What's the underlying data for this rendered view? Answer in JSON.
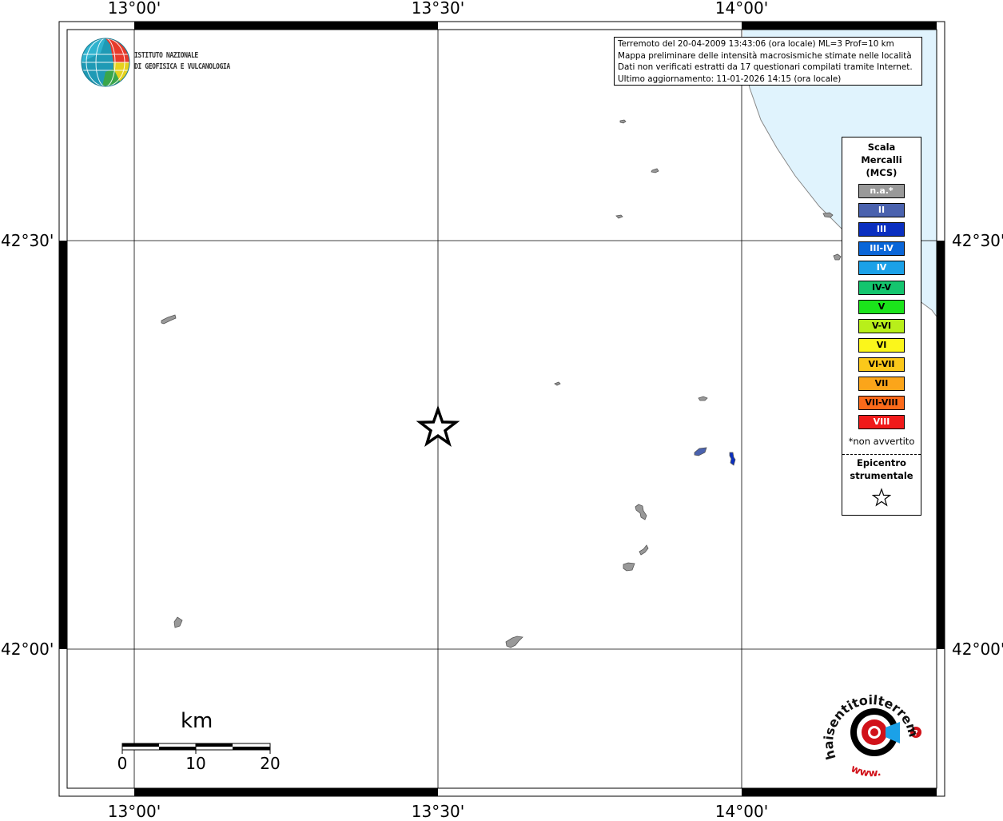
{
  "map": {
    "lon_ticks": [
      "13°00'",
      "13°30'",
      "14°00'"
    ],
    "lat_ticks": [
      "42°30'",
      "42°00'"
    ],
    "sea_color": "#e0f3fd",
    "land_color": "#ffffff"
  },
  "info": {
    "lines": [
      "Terremoto del 20-04-2009 13:43:06 (ora locale) ML=3 Prof=10 km",
      "Mappa preliminare delle intensità macrosismiche stimate nelle località",
      "Dati non verificati estratti da 17 questionari compilati tramite Internet.",
      "Ultimo aggiornamento: 11-01-2026 14:15 (ora locale)"
    ]
  },
  "logo_ingv": {
    "line1": "ISTITUTO NAZIONALE",
    "line2": "DI GEOFISICA E VULCANOLOGIA"
  },
  "legend": {
    "title_lines": [
      "Scala",
      "Mercalli",
      "(MCS)"
    ],
    "classes": [
      {
        "label": "n.a.*",
        "color": "#999999",
        "text_color": "#ffffff"
      },
      {
        "label": "II",
        "color": "#4a62ae",
        "text_color": "#ffffff"
      },
      {
        "label": "III",
        "color": "#0a2fc0",
        "text_color": "#ffffff"
      },
      {
        "label": "III-IV",
        "color": "#0a66d8",
        "text_color": "#ffffff"
      },
      {
        "label": "IV",
        "color": "#1ba1e8",
        "text_color": "#ffffff"
      },
      {
        "label": "IV-V",
        "color": "#14c56e",
        "text_color": "#000000"
      },
      {
        "label": "V",
        "color": "#1be41b",
        "text_color": "#000000"
      },
      {
        "label": "V-VI",
        "color": "#b8ef1a",
        "text_color": "#000000"
      },
      {
        "label": "VI",
        "color": "#fbf61b",
        "text_color": "#000000"
      },
      {
        "label": "VI-VII",
        "color": "#fbc81a",
        "text_color": "#000000"
      },
      {
        "label": "VII",
        "color": "#fba51a",
        "text_color": "#000000"
      },
      {
        "label": "VII-VIII",
        "color": "#fb6a1a",
        "text_color": "#000000"
      },
      {
        "label": "VIII",
        "color": "#f01a1a",
        "text_color": "#ffffff"
      }
    ],
    "na_note": "*non avvertito",
    "epicenter_lines": [
      "Epicentro",
      "strumentale"
    ]
  },
  "scalebar": {
    "unit": "km",
    "labels": [
      "0",
      "10",
      "20"
    ]
  },
  "hsit_logo": {
    "brand": "haisentitoilterremoto.it",
    "url_text": "www."
  }
}
